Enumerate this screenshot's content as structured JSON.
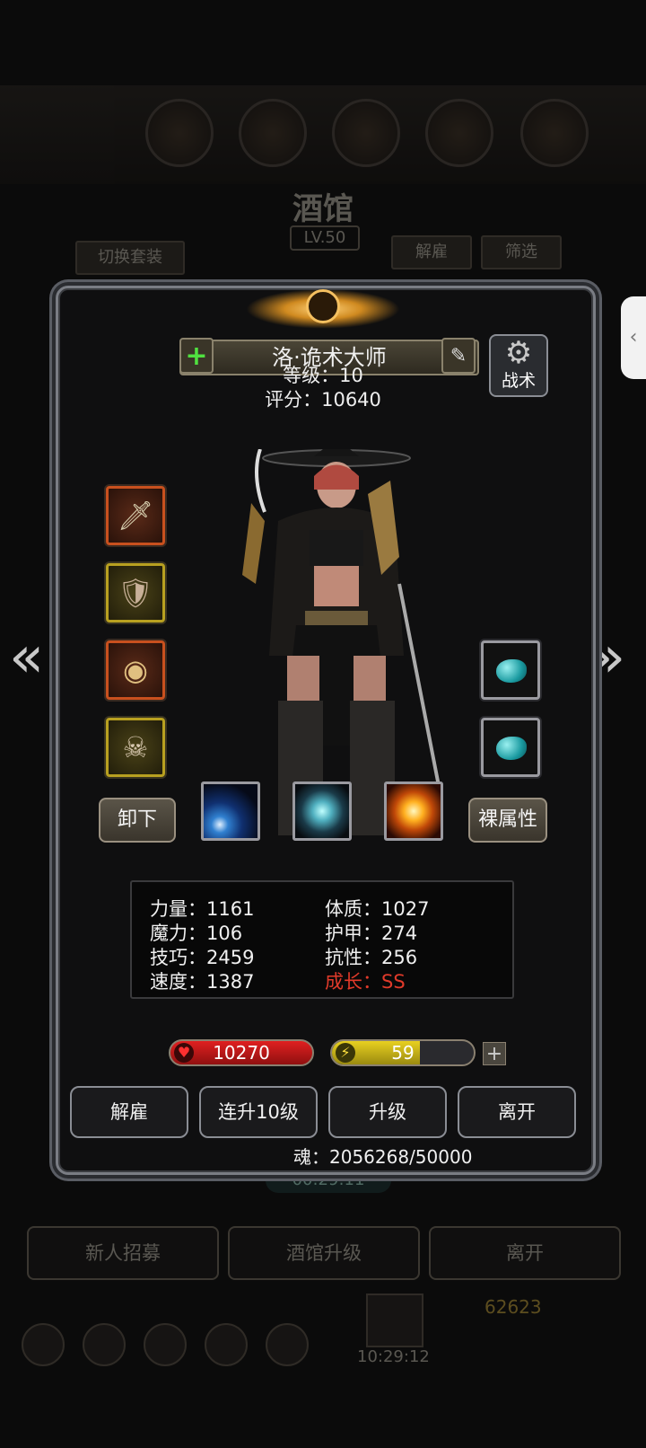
{
  "background": {
    "title": "酒馆",
    "level_badge": "LV.50",
    "switch_outfit": "切换套装",
    "dismiss": "解雇",
    "filter": "筛选",
    "timer": "00:29:11",
    "recruit": "新人招募",
    "upgrade_tavern": "酒馆升级",
    "leave": "离开",
    "gold": "62623",
    "clock": "10:29:12"
  },
  "hero": {
    "name": "洛·诡术大师",
    "level_text": "等级：10",
    "score_text": "评分：10640",
    "tactics_label": "战术"
  },
  "buttons": {
    "unequip": "卸下",
    "base_attr": "裸属性"
  },
  "equipment_icons": [
    "weapon-icon",
    "armor-icon",
    "ring-icon",
    "mask-icon"
  ],
  "gem_icons": [
    "turquoise-gem-icon",
    "turquoise-gem-icon"
  ],
  "skills": [
    "light-beam-skill-icon",
    "slash-skill-icon",
    "fire-burst-skill-icon"
  ],
  "stats": {
    "strength": "力量：1161",
    "magic": "魔力：106",
    "skill": "技巧：2459",
    "speed": "速度：1387",
    "constitution": "体质：1027",
    "armor": "护甲：274",
    "resistance": "抗性：256",
    "growth": "成长：SS"
  },
  "bars": {
    "hp": "10270",
    "energy": "59",
    "energy_fill_fraction": 0.62
  },
  "actions": {
    "dismiss": "解雇",
    "level_up_10": "连升10级",
    "upgrade": "升级",
    "leave": "离开"
  },
  "soul": "魂：2056268/50000",
  "colors": {
    "growth_red": "#e03a2a",
    "hp_red": "#e02020",
    "energy_yellow": "#e8d020",
    "plus_green": "#50e040"
  }
}
